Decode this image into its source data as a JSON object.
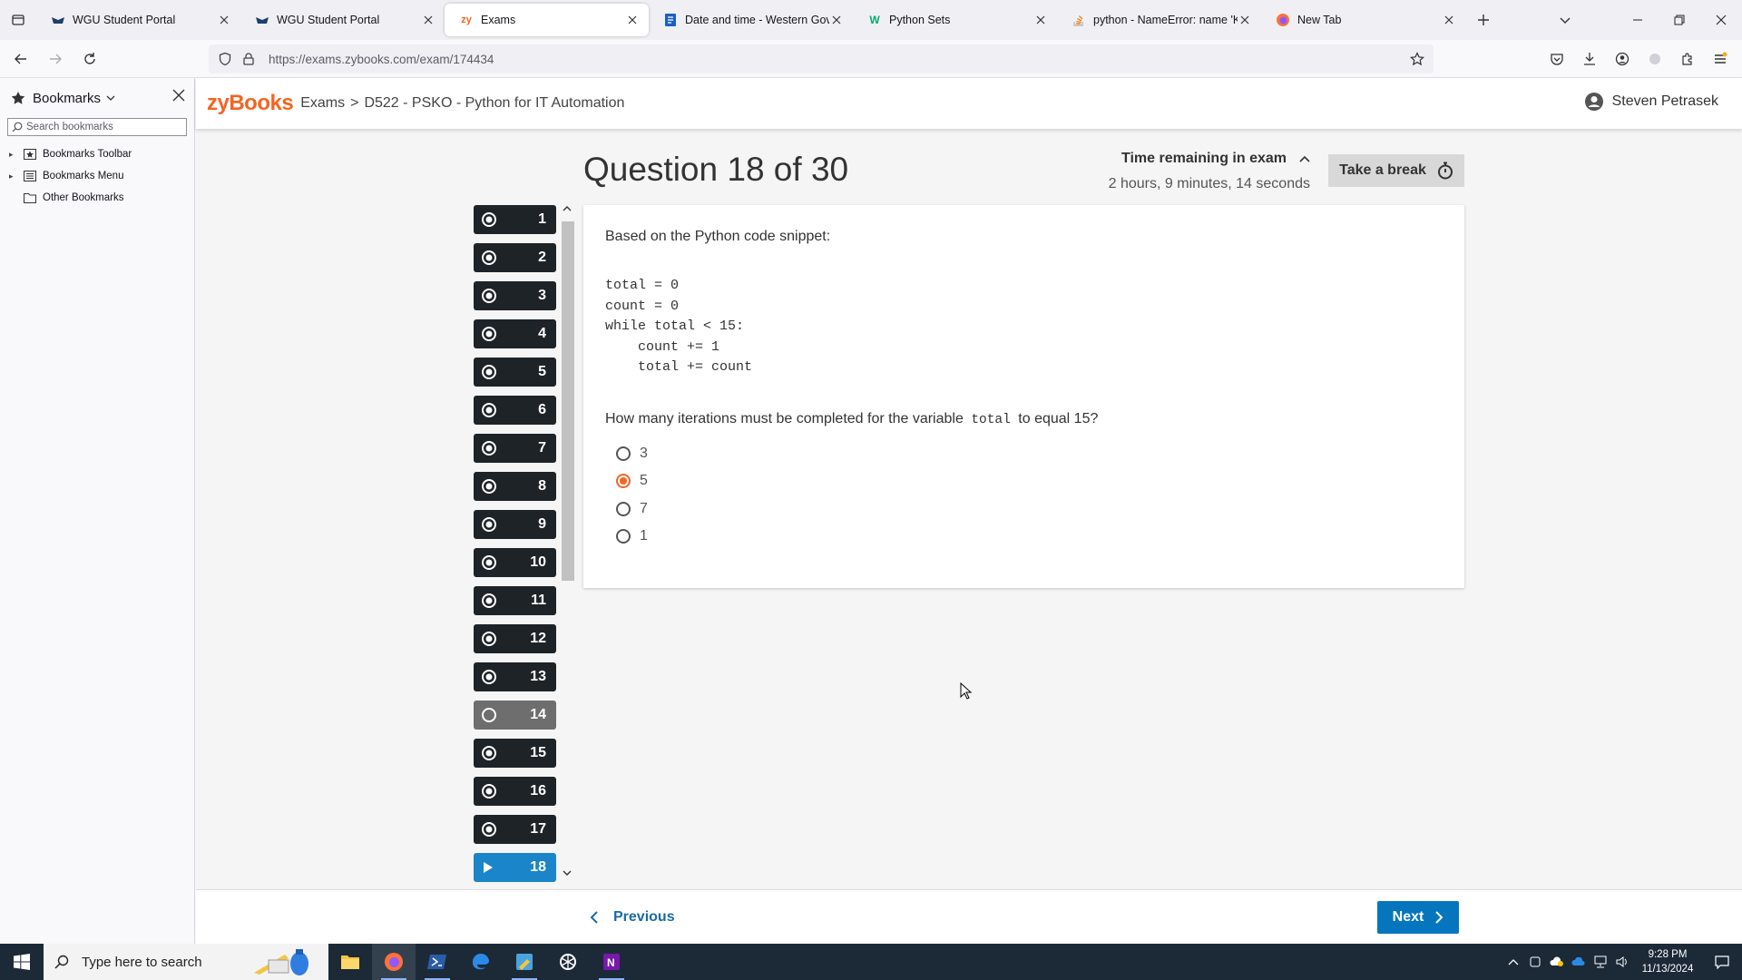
{
  "browser": {
    "tabs": [
      {
        "title": "WGU Student Portal",
        "icon": "wgu-owl-icon",
        "active": false
      },
      {
        "title": "WGU Student Portal",
        "icon": "wgu-owl-icon",
        "active": false
      },
      {
        "title": "Exams",
        "icon": "zybooks-icon",
        "active": true
      },
      {
        "title": "Date and time - Western Gover",
        "icon": "wgu-doc-icon",
        "active": false
      },
      {
        "title": "Python Sets",
        "icon": "w3schools-icon",
        "active": false
      },
      {
        "title": "python - NameError: name 'Key",
        "icon": "stackoverflow-icon",
        "active": false
      },
      {
        "title": "New Tab",
        "icon": "firefox-icon",
        "active": false
      }
    ],
    "url": "https://exams.zybooks.com/exam/174434"
  },
  "sidebar": {
    "title": "Bookmarks",
    "search_placeholder": "Search bookmarks",
    "items": [
      {
        "label": "Bookmarks Toolbar"
      },
      {
        "label": "Bookmarks Menu"
      },
      {
        "label": "Other Bookmarks"
      }
    ]
  },
  "header": {
    "logo": "zyBooks",
    "breadcrumb_exams": "Exams",
    "breadcrumb_sep": ">",
    "breadcrumb_course": "D522 - PSKO - Python for IT Automation",
    "user_name": "Steven Petrasek"
  },
  "exam": {
    "question_title": "Question 18 of 30",
    "time_label": "Time remaining in exam",
    "time_value": "2 hours, 9 minutes, 14 seconds",
    "break_label": "Take a break",
    "nav": [
      {
        "n": "1",
        "state": "answered"
      },
      {
        "n": "2",
        "state": "answered"
      },
      {
        "n": "3",
        "state": "answered"
      },
      {
        "n": "4",
        "state": "answered"
      },
      {
        "n": "5",
        "state": "answered"
      },
      {
        "n": "6",
        "state": "answered"
      },
      {
        "n": "7",
        "state": "answered"
      },
      {
        "n": "8",
        "state": "answered"
      },
      {
        "n": "9",
        "state": "answered"
      },
      {
        "n": "10",
        "state": "answered"
      },
      {
        "n": "11",
        "state": "answered"
      },
      {
        "n": "12",
        "state": "answered"
      },
      {
        "n": "13",
        "state": "answered"
      },
      {
        "n": "14",
        "state": "unanswered"
      },
      {
        "n": "15",
        "state": "answered"
      },
      {
        "n": "16",
        "state": "answered"
      },
      {
        "n": "17",
        "state": "answered"
      },
      {
        "n": "18",
        "state": "current"
      }
    ],
    "prompt": "Based on the Python code snippet:",
    "code": "total = 0\ncount = 0\nwhile total < 15:\n    count += 1\n    total += count",
    "question_before": "How many iterations must be completed for the variable",
    "question_code": "total",
    "question_after": "to equal 15?",
    "choices": [
      {
        "label": "3",
        "selected": false
      },
      {
        "label": "5",
        "selected": true
      },
      {
        "label": "7",
        "selected": false
      },
      {
        "label": "1",
        "selected": false
      }
    ],
    "prev_label": "Previous",
    "next_label": "Next"
  },
  "taskbar": {
    "search_placeholder": "Type here to search",
    "apps": [
      "file-explorer-icon",
      "firefox-icon",
      "powershell-icon",
      "edge-icon",
      "paint-icon",
      "chatgpt-icon",
      "onenote-icon"
    ],
    "time": "9:28 PM",
    "date": "11/13/2024"
  },
  "colors": {
    "brand": "#f26522",
    "primary": "#0576bd",
    "nav_answered": "#1e2328",
    "nav_unanswered": "#6e6e6e",
    "nav_current": "#1a85c8"
  }
}
